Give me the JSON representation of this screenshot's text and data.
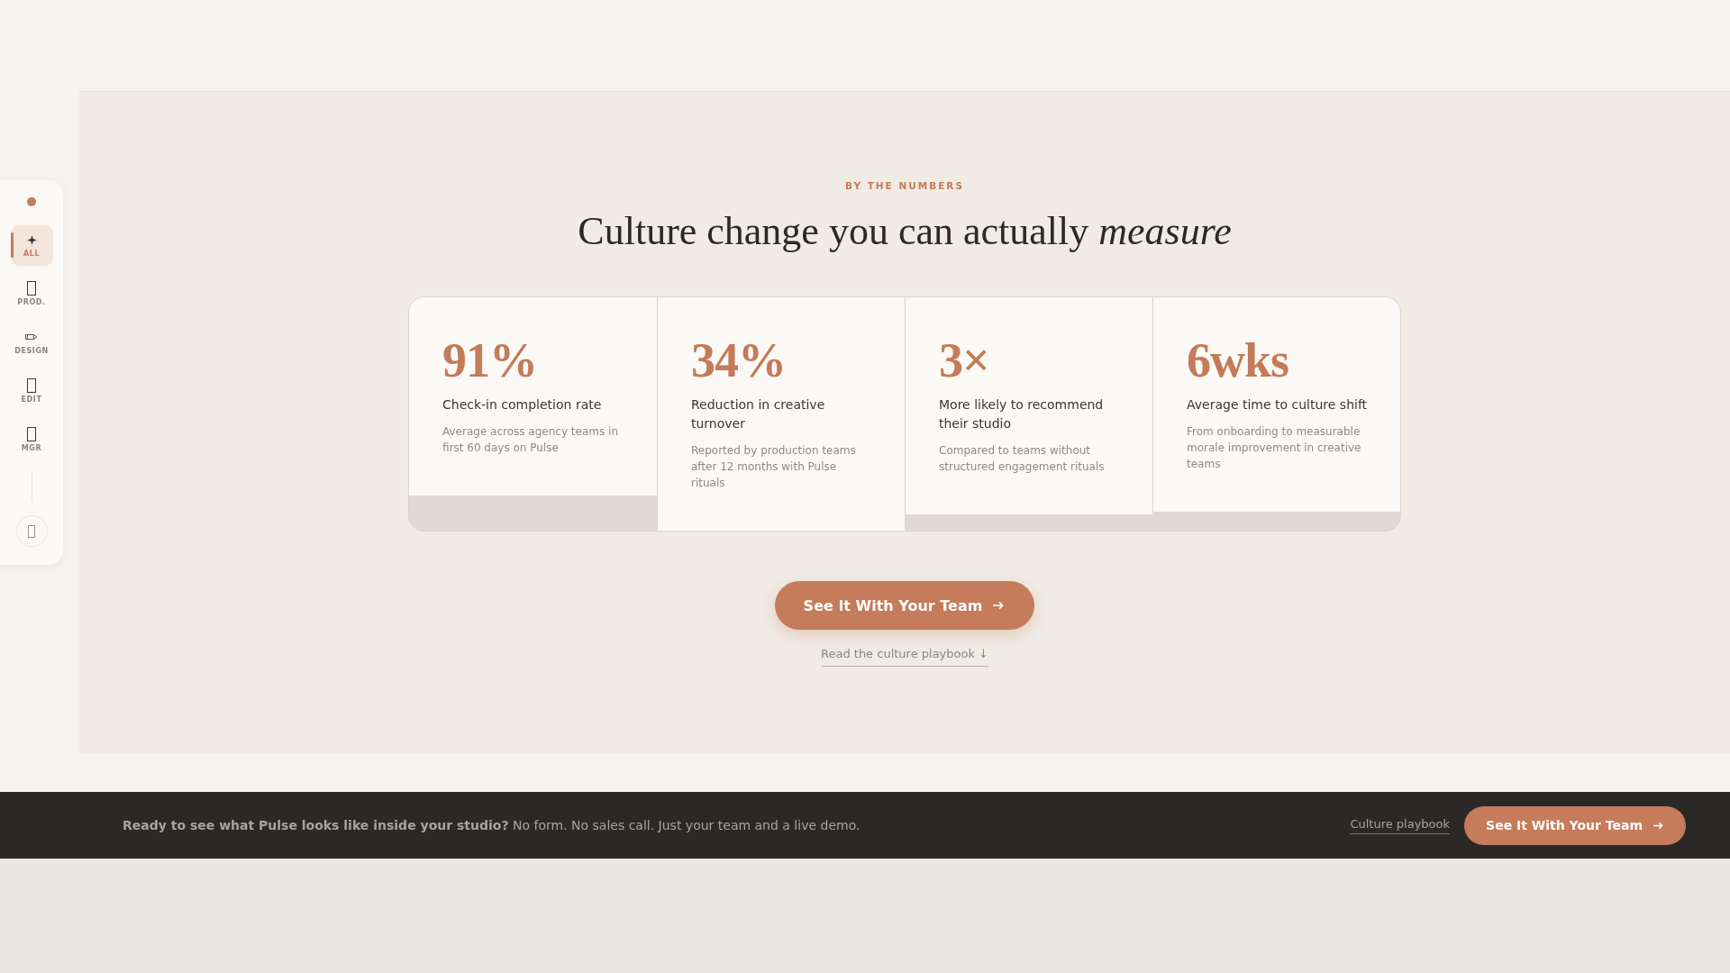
{
  "sidebar": {
    "items": [
      {
        "label": "ALL",
        "selected": true
      },
      {
        "label": "PROD.",
        "selected": false
      },
      {
        "label": "DESIGN",
        "selected": false
      },
      {
        "label": "EDIT",
        "selected": false
      },
      {
        "label": "MGR",
        "selected": false
      }
    ]
  },
  "section": {
    "eyebrow": "BY THE NUMBERS",
    "heading": "Culture change you can actually *measure*",
    "stats": [
      {
        "value": "91%",
        "title": "Check-in completion rate",
        "description": "Average across agency teams in first 60 days on Pulse"
      },
      {
        "value": "34%",
        "title": "Reduction in creative turnover",
        "description": "Reported by production teams after 12 months with Pulse rituals"
      },
      {
        "value": "3×",
        "title": "More likely to recommend their studio",
        "description": "Compared to teams without structured engagement rituals"
      },
      {
        "value": "6wks",
        "title": "Average time to culture shift",
        "description": "From onboarding to measurable morale improvement in creative teams"
      }
    ],
    "primary_button": "See It With Your Team",
    "secondary_link": "Read the culture playbook ↓"
  },
  "cta_bar": {
    "message": "**Ready to see what Pulse looks like inside your studio?** No form. No sales call. Just your team and a live demo.",
    "link": "Culture playbook",
    "button": "See It With Your Team"
  }
}
